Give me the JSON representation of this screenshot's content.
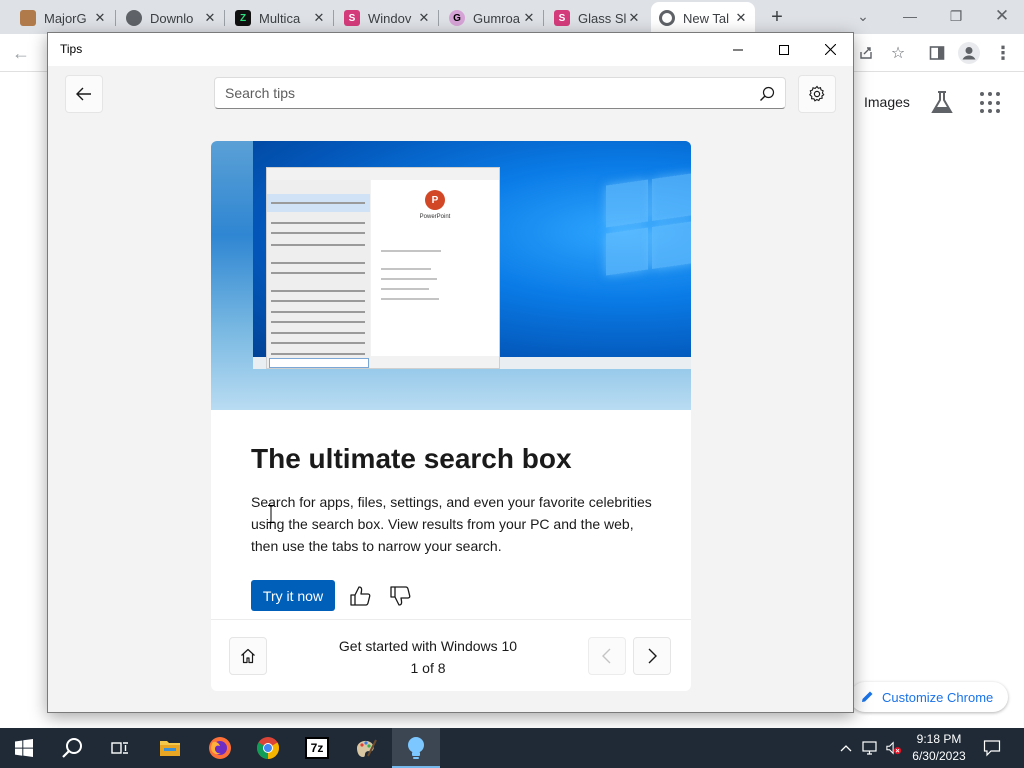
{
  "chrome": {
    "tabs": [
      {
        "title": "MajorG",
        "favicon_color": "#b07a4a",
        "favicon_glyph": ""
      },
      {
        "title": "Downlo",
        "favicon_color": "#5f6368",
        "favicon_glyph": ""
      },
      {
        "title": "Multica",
        "favicon_color": "#111111",
        "favicon_glyph": "Z"
      },
      {
        "title": "Windov",
        "favicon_color": "#d43b7b",
        "favicon_glyph": "S"
      },
      {
        "title": "Gumroa",
        "favicon_color": "#d6a3d6",
        "favicon_glyph": "G"
      },
      {
        "title": "Glass Sl",
        "favicon_color": "#d43b7b",
        "favicon_glyph": "S"
      },
      {
        "title": "New Tal",
        "favicon_color": "#5f6368",
        "favicon_glyph": ""
      }
    ],
    "new_tab_label": "+",
    "images_link": "Images",
    "customize_label": "Customize Chrome"
  },
  "tips_app": {
    "window_title": "Tips",
    "search": {
      "placeholder": "Search tips",
      "value": ""
    },
    "card": {
      "heading": "The ultimate search box",
      "description": "Search for apps, files, settings, and even your favorite celebrities using the search box. View results from your PC and the web, then use the tabs to narrow your search.",
      "try_button": "Try it now",
      "hero_app_name": "PowerPoint",
      "footer_title": "Get started with Windows 10",
      "footer_count": "1 of 8"
    }
  },
  "taskbar": {
    "apps": [
      "start-icon",
      "search-icon",
      "task-view-icon",
      "file-explorer-icon",
      "firefox-icon",
      "chrome-icon",
      "7zip-icon",
      "paint-icon",
      "tips-icon"
    ],
    "active_app": "tips-icon",
    "sevenzip_label": "7z",
    "clock_time": "9:18 PM",
    "clock_date": "6/30/2023"
  },
  "colors": {
    "accent": "#005fb8",
    "taskbar": "#1f2a36",
    "chrome_link": "#1a73e8"
  }
}
